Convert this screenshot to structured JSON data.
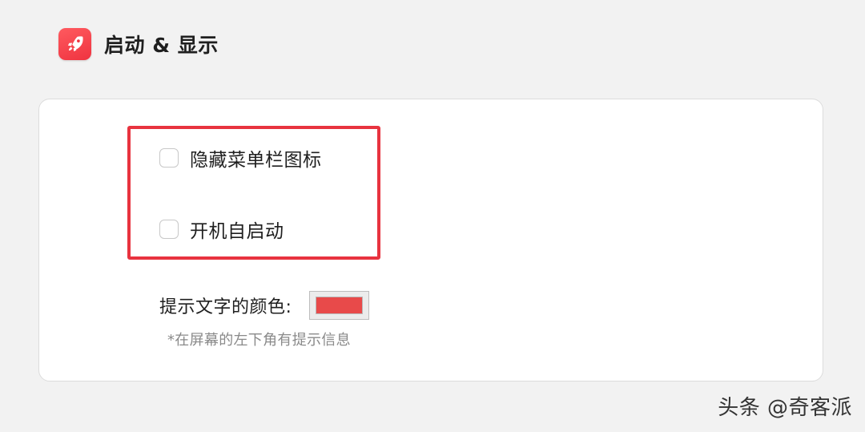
{
  "section": {
    "title": "启动 & 显示",
    "icon": "rocket-icon",
    "icon_color": "#ef3340"
  },
  "options": [
    {
      "label": "隐藏菜单栏图标",
      "checked": false
    },
    {
      "label": "开机自启动",
      "checked": false
    }
  ],
  "highlight_color": "#e8333f",
  "prompt_color": {
    "label": "提示文字的颜色:",
    "value": "#e84a4a",
    "hint": "*在屏幕的左下角有提示信息"
  },
  "watermark": "头条 @奇客派"
}
